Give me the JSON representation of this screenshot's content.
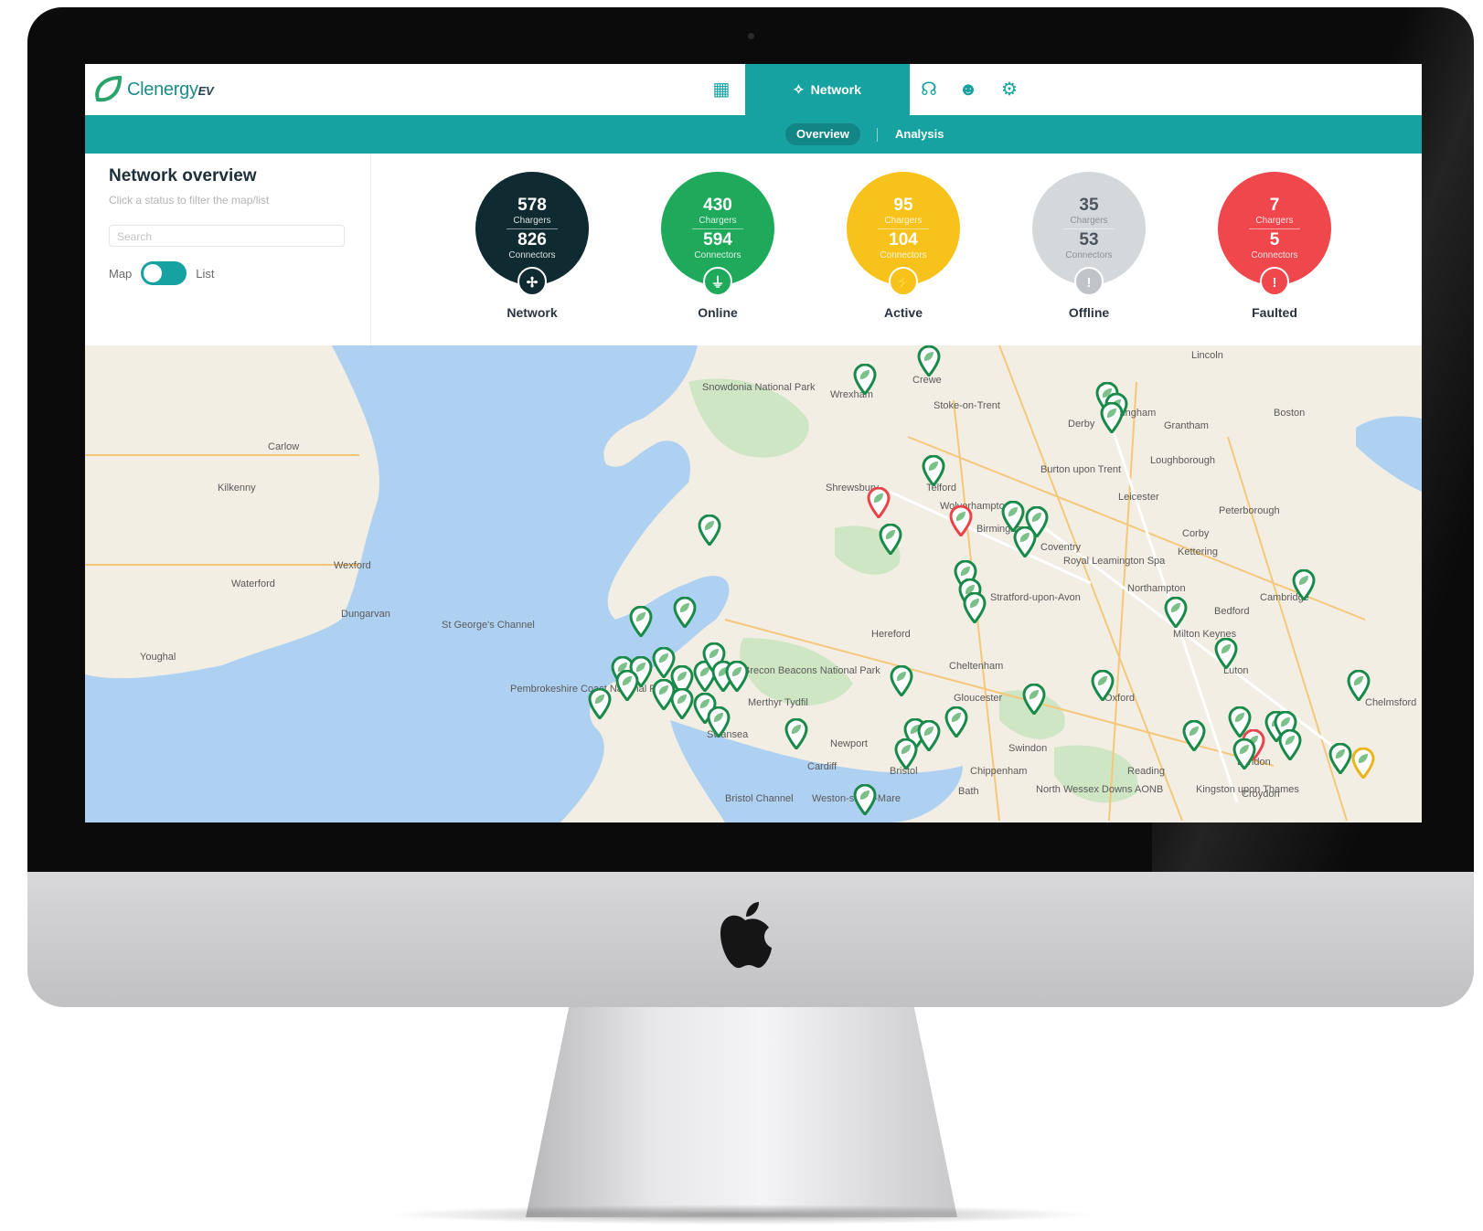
{
  "brand": {
    "name": "Clenergy",
    "suffix": "EV"
  },
  "nav": {
    "active_label": "Network",
    "icons": [
      "grid-icon",
      "network-icon",
      "support-icon",
      "users-icon",
      "settings-icon"
    ]
  },
  "subtabs": {
    "overview": "Overview",
    "analysis": "Analysis"
  },
  "panel": {
    "title": "Network overview",
    "hint": "Click a status to filter the map/list",
    "search_placeholder": "Search",
    "toggle_left": "Map",
    "toggle_right": "List"
  },
  "stats": [
    {
      "label": "Network",
      "chargers": "578",
      "chargers_label": "Chargers",
      "connectors": "826",
      "connectors_label": "Connectors",
      "color": "#0f2a30",
      "badge_icon": "network-icon"
    },
    {
      "label": "Online",
      "chargers": "430",
      "chargers_label": "Chargers",
      "connectors": "594",
      "connectors_label": "Connectors",
      "color": "#1eaa5a",
      "badge_icon": "plug-icon"
    },
    {
      "label": "Active",
      "chargers": "95",
      "chargers_label": "Chargers",
      "connectors": "104",
      "connectors_label": "Connectors",
      "color": "#f7c21a",
      "badge_icon": "bolt-icon"
    },
    {
      "label": "Offline",
      "chargers": "35",
      "chargers_label": "Chargers",
      "connectors": "53",
      "connectors_label": "Connectors",
      "color": "#d5d8db",
      "badge_icon": "exclamation-icon"
    },
    {
      "label": "Faulted",
      "chargers": "7",
      "chargers_label": "Chargers",
      "connectors": "5",
      "connectors_label": "Connectors",
      "color": "#f0474c",
      "badge_icon": "exclamation-icon"
    }
  ],
  "map": {
    "places": [
      "Snowdonia National Park",
      "Stoke-on-Trent",
      "Derby",
      "Nottingham",
      "Grantham",
      "Boston",
      "Wrexham",
      "Crewe",
      "Shrewsbury",
      "Telford",
      "Wolverhampton",
      "Birmingham",
      "Coventry",
      "Leicester",
      "Peterborough",
      "Northampton",
      "Bedford",
      "Cambridge",
      "Milton Keynes",
      "Hereford",
      "Cheltenham",
      "Gloucester",
      "Oxford",
      "Swindon",
      "Reading",
      "London",
      "Chelmsford",
      "Cardiff",
      "Newport",
      "Bristol",
      "Bath",
      "Brecon Beacons National Park",
      "Pembrokeshire Coast National Park",
      "Waterford",
      "Kilkenny",
      "Carlow",
      "Wexford",
      "Dungarvan",
      "Youghal",
      "Bristol Channel",
      "St George's Channel",
      "Lincoln",
      "Loughborough",
      "Burton upon Trent",
      "Kettering",
      "Corby",
      "Royal Leamington Spa",
      "Stratford-upon-Avon",
      "Chippenham",
      "North Wessex Downs AONB",
      "Croydon",
      "Kingston upon Thames",
      "Weston-super-Mare",
      "Swansea",
      "Merthyr Tydfil",
      "Luton"
    ],
    "pin_colors": {
      "online": "#1a8a4a",
      "faulted": "#e8454b",
      "active": "#e9b51b"
    }
  }
}
